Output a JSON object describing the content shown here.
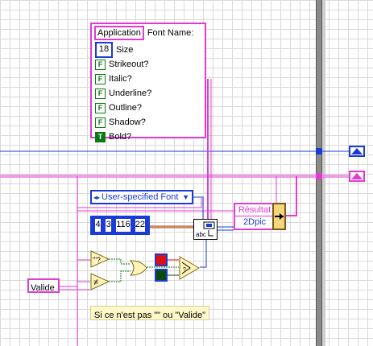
{
  "cluster": {
    "header_tag": "Application",
    "header_label": "Font Name:",
    "size_value": "18",
    "size_label": "Size",
    "booleans": [
      {
        "type": "F",
        "label": "Strikeout?"
      },
      {
        "type": "F",
        "label": "Italic?"
      },
      {
        "type": "F",
        "label": "Underline?"
      },
      {
        "type": "F",
        "label": "Outline?"
      },
      {
        "type": "F",
        "label": "Shadow?"
      },
      {
        "type": "T",
        "label": "Bold?"
      }
    ]
  },
  "ring": {
    "selected": "User-specified Font",
    "arrow": "▼"
  },
  "rect_const": {
    "values": [
      "4",
      "3",
      "116",
      "22"
    ]
  },
  "result": {
    "label": "Résultat",
    "sub": "2Dpic"
  },
  "valide_label": "Valide",
  "comment": "Si ce n'est pas \"\" ou \"Valide\"",
  "colors": {
    "pink": "#e23ad2",
    "blue": "#1a3bd6",
    "green": "#0a7a10",
    "red": "#e01010",
    "bool_green": "#0a4a10"
  },
  "icons": [
    "draw-text-vi-icon",
    "empty-string-compare-icon",
    "not-equal-icon",
    "or-gate-icon",
    "select-icon",
    "bundle-icon"
  ]
}
